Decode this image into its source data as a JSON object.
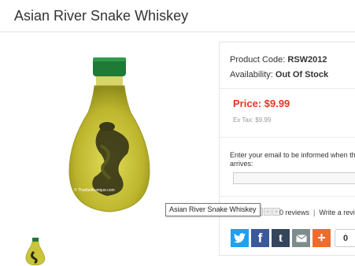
{
  "product": {
    "title": "Asian River Snake Whiskey",
    "code_label": "Product Code:",
    "code_value": "RSW2012",
    "availability_label": "Availability:",
    "availability_value": "Out Of Stock",
    "price": "Price: $9.99",
    "ex_tax": "Ex Tax: $9.99",
    "image_watermark": "© Thaifanthunique.com"
  },
  "notify": {
    "text": "Enter your email to be informed when this arrives:",
    "input_value": ""
  },
  "rating": {
    "reviews": "0 reviews",
    "divider": "|",
    "write": "Write a review"
  },
  "share": {
    "count": "0",
    "buttons": [
      {
        "name": "twitter",
        "glyph": "t",
        "color": "#1da1f2"
      },
      {
        "name": "facebook",
        "glyph": "f",
        "color": "#3b5998"
      },
      {
        "name": "tumblr",
        "glyph": "t",
        "color": "#35465c"
      },
      {
        "name": "email",
        "glyph": "✉",
        "color": "#7f8c8d"
      },
      {
        "name": "more",
        "glyph": "+",
        "color": "#f26b2a"
      }
    ]
  },
  "tooltip": "Asian River Snake Whiskey",
  "colors": {
    "price": "#e03a1e",
    "cap": "#1f7a35",
    "liquid": "#c9c43a"
  }
}
